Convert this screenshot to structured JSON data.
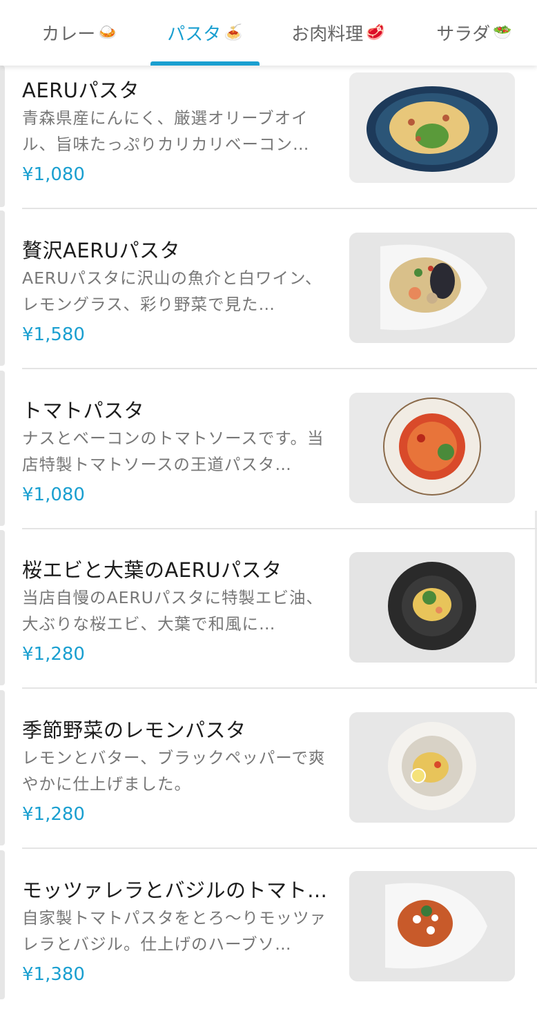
{
  "tabs": [
    {
      "label": "カレー",
      "emoji": "🍛"
    },
    {
      "label": "パスタ",
      "emoji": "🍝",
      "active": true
    },
    {
      "label": "お肉料理",
      "emoji": "🥩"
    },
    {
      "label": "サラダ",
      "emoji": "🥗"
    }
  ],
  "items": [
    {
      "name": "AERUパスタ",
      "description": "青森県産にんにく、厳選オリーブオイル、旨味たっぷりカリカリベーコン…",
      "price": "¥1,080"
    },
    {
      "name": "贅沢AERUパスタ",
      "description": "AERUパスタに沢山の魚介と白ワイン、レモングラス、彩り野菜で見た…",
      "price": "¥1,580"
    },
    {
      "name": "トマトパスタ",
      "description": "ナスとベーコンのトマトソースです。当店特製トマトソースの王道パスタ…",
      "price": "¥1,080"
    },
    {
      "name": "桜エビと大葉のAERUパスタ",
      "description": "当店自慢のAERUパスタに特製エビ油、大ぶりな桜エビ、大葉で和風に…",
      "price": "¥1,280"
    },
    {
      "name": "季節野菜のレモンパスタ",
      "description": "レモンとバター、ブラックペッパーで爽やかに仕上げました。",
      "price": "¥1,280"
    },
    {
      "name": "モッツァレラとバジルのトマト…",
      "description": "自家製トマトパスタをとろ〜りモッツァレラとバジル。仕上げのハーブソ…",
      "price": "¥1,380"
    }
  ],
  "colors": {
    "accent": "#1a9fd0",
    "text": "#1c1c1c",
    "muted": "#777777",
    "divider": "#e4e4e4"
  }
}
